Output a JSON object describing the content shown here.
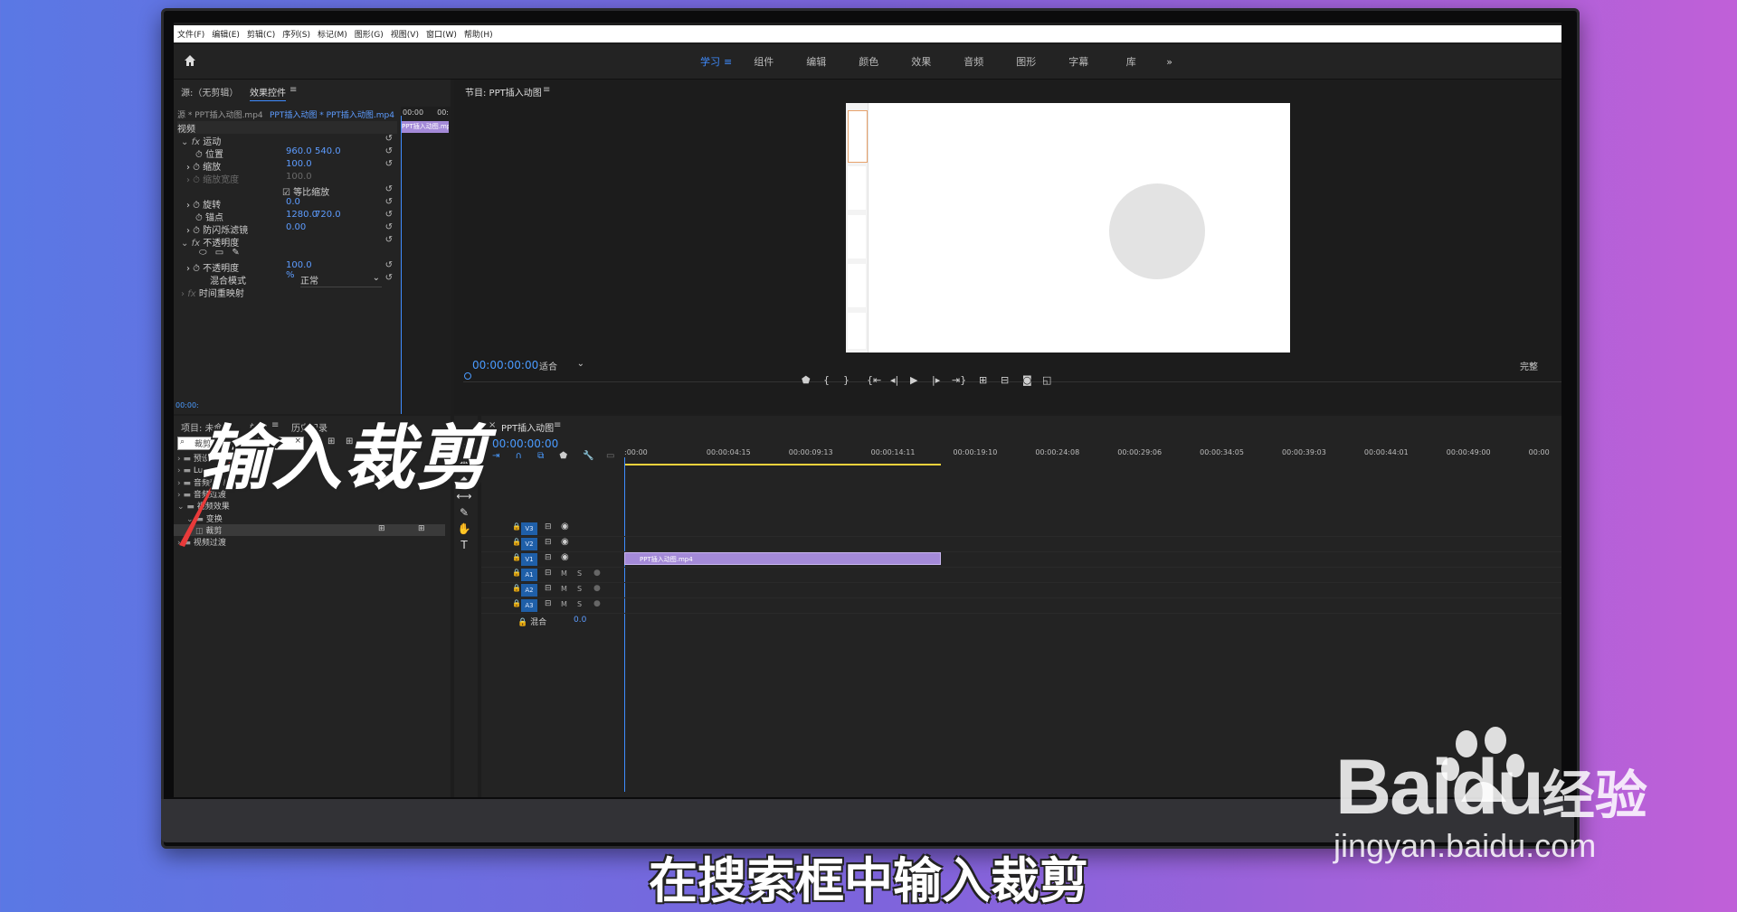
{
  "menu": [
    "文件(F)",
    "编辑(E)",
    "剪辑(C)",
    "序列(S)",
    "标记(M)",
    "图形(G)",
    "视图(V)",
    "窗口(W)",
    "帮助(H)"
  ],
  "workspaces": [
    "学习",
    "组件",
    "编辑",
    "颜色",
    "效果",
    "音频",
    "图形",
    "字幕",
    "库"
  ],
  "workspaces_more": "»",
  "workspace_active_menu": "≡",
  "source_panel": {
    "source_tab": "源:（无剪辑）",
    "effect_controls_tab": "效果控件",
    "menu_icon": "≡",
    "clip_source": "源 * PPT插入动图.mp4",
    "clip_sequence": "PPT插入动图 * PPT插入动图.mp4",
    "mini_timecode_start": "00:00",
    "mini_timecode_end": "00:",
    "mini_clip": "PPT插入动图.mp4",
    "video_header": "视频",
    "motion": "运动",
    "position_label": "位置",
    "position_x": "960.0",
    "position_y": "540.0",
    "scale_label": "缩放",
    "scale_value": "100.0",
    "scale_width_label": "缩放宽度",
    "scale_width_value": "100.0",
    "uniform_scale_label": "等比缩放",
    "rotation_label": "旋转",
    "rotation_value": "0.0",
    "anchor_label": "锚点",
    "anchor_x": "1280.0",
    "anchor_y": "720.0",
    "antiflicker_label": "防闪烁滤镜",
    "antiflicker_value": "0.00",
    "opacity_group": "不透明度",
    "opacity_label": "不透明度",
    "opacity_value": "100.0 %",
    "blend_label": "混合模式",
    "blend_value": "正常",
    "time_remap": "时间重映射",
    "bottom_timecode": "00:00:"
  },
  "program_panel": {
    "title": "节目: PPT插入动图",
    "menu_icon": "≡",
    "timecode": "00:00:00:00",
    "fit": "适合",
    "quality": "完整"
  },
  "project_panel": {
    "project_tab": "项目: 未命名",
    "effects_tab": "效果",
    "menu_icon": "≡",
    "history_tab": "历史记录",
    "search_value": "裁剪",
    "tree": [
      {
        "label": "预设",
        "indent": 1,
        "expanded": false
      },
      {
        "label": "Lumetri 预设",
        "indent": 1,
        "expanded": false
      },
      {
        "label": "音频效果",
        "indent": 1,
        "expanded": false
      },
      {
        "label": "音频过渡",
        "indent": 1,
        "expanded": false
      },
      {
        "label": "视频效果",
        "indent": 1,
        "expanded": true
      },
      {
        "label": "变换",
        "indent": 2,
        "expanded": true
      },
      {
        "label": "裁剪",
        "indent": 3,
        "selected": true
      },
      {
        "label": "视频过渡",
        "indent": 1,
        "expanded": false
      }
    ]
  },
  "timeline": {
    "tab": "PPT插入动图",
    "menu_icon": "≡",
    "close_icon": "×",
    "timecode": "00:00:00:00",
    "ruler": [
      ":00:00",
      "00:00:04:15",
      "00:00:09:13",
      "00:00:14:11",
      "00:00:19:10",
      "00:00:24:08",
      "00:00:29:06",
      "00:00:34:05",
      "00:00:39:03",
      "00:00:44:01",
      "00:00:49:00",
      "00:00"
    ],
    "tracks": [
      {
        "name": "V3"
      },
      {
        "name": "V2"
      },
      {
        "name": "V1"
      },
      {
        "name": "A1"
      },
      {
        "name": "A2"
      },
      {
        "name": "A3"
      }
    ],
    "clip_label": "PPT插入动图.mp4",
    "mix_label": "混合",
    "mix_value": "0.0",
    "mute": "M",
    "solo": "S"
  },
  "overlay_title": "输入裁剪",
  "subtitle": "在搜索框中输入裁剪",
  "watermark": {
    "main_a": "Bai",
    "main_b": "du",
    "suffix": "经验",
    "url": "jingyan.baidu.com"
  },
  "colors": {
    "accent": "#3f8cff",
    "clip": "#a48ad8",
    "arrow": "#e83a3a",
    "timeline_bar": "#f2d23c"
  }
}
